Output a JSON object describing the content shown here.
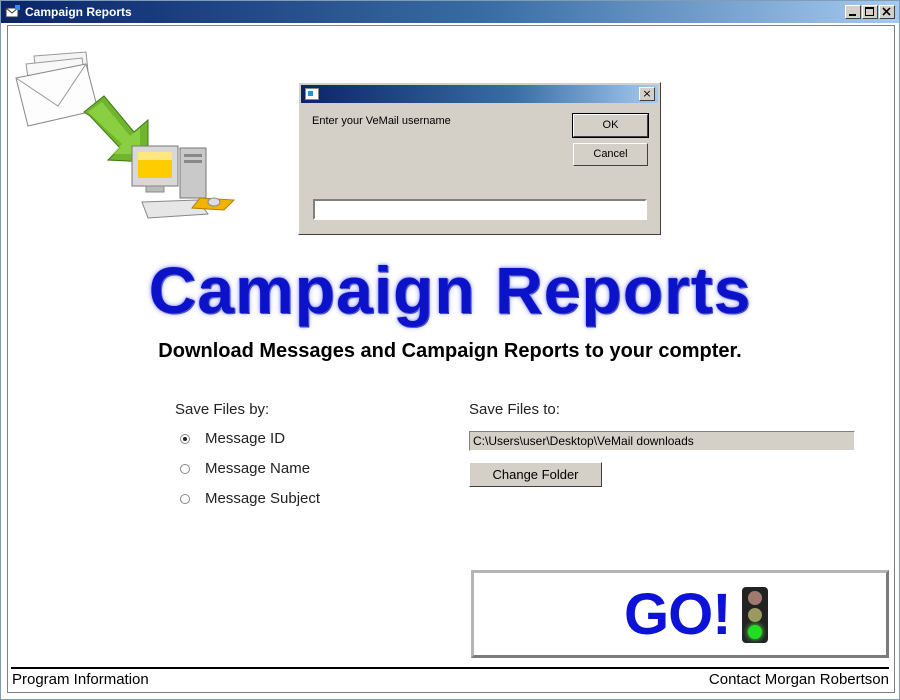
{
  "window": {
    "title": "Campaign Reports",
    "controls": [
      "_",
      "□",
      "×"
    ]
  },
  "dialog": {
    "prompt": "Enter your VeMail username",
    "ok_label": "OK",
    "cancel_label": "Cancel",
    "close_label": "×",
    "username_value": ""
  },
  "header": {
    "title": "Campaign Reports",
    "subtitle": "Download Messages and Campaign Reports to your compter."
  },
  "save_by": {
    "label": "Save Files by:",
    "options": [
      {
        "label": "Message ID",
        "checked": true
      },
      {
        "label": "Message Name",
        "checked": false
      },
      {
        "label": "Message Subject",
        "checked": false
      }
    ]
  },
  "save_to": {
    "label": "Save Files to:",
    "path": "C:\\Users\\user\\Desktop\\VeMail downloads",
    "change_label": "Change Folder"
  },
  "go": {
    "label": "GO!",
    "traffic_light": {
      "red": "#a07a70",
      "yellow": "#9a9a60",
      "green": "#22dd22"
    }
  },
  "footer": {
    "left": "Program Information",
    "right": "Contact Morgan Robertson"
  },
  "colors": {
    "accent_blue": "#0c12c8",
    "title_bar": "#0a246a",
    "dialog_face": "#d4d0c8"
  },
  "icons": {
    "app": "email-download-icon",
    "illustration": "email-to-computer-illustration"
  }
}
